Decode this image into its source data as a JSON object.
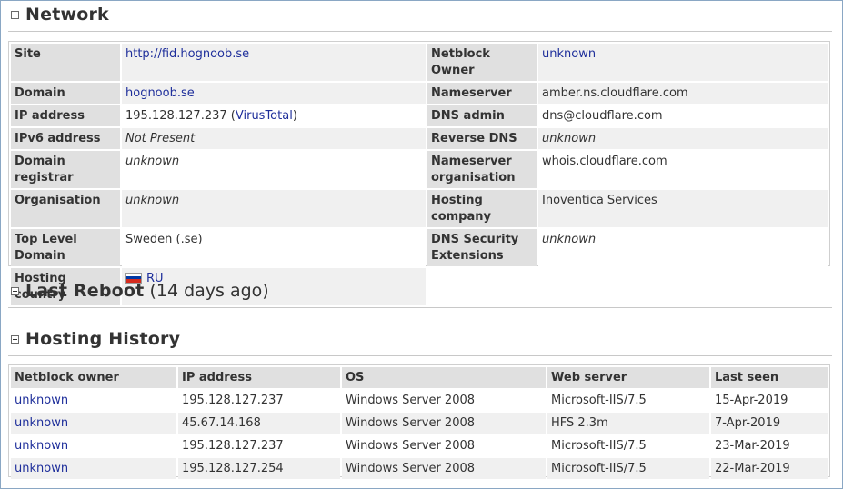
{
  "network": {
    "title": "Network",
    "left_rows": [
      {
        "label": "Site",
        "value": "http://fid.hognoob.se",
        "kind": "link"
      },
      {
        "label": "Domain",
        "value": "hognoob.se",
        "kind": "link"
      },
      {
        "label": "IP address",
        "value": "195.128.127.237",
        "extra_link": "VirusTotal",
        "kind": "ip"
      },
      {
        "label": "IPv6 address",
        "value": "Not Present",
        "kind": "italic"
      },
      {
        "label": "Domain registrar",
        "value": "unknown",
        "kind": "italic"
      },
      {
        "label": "Organisation",
        "value": "unknown",
        "kind": "italic"
      },
      {
        "label": "Top Level Domain",
        "value": "Sweden (.se)",
        "kind": "text"
      },
      {
        "label": "Hosting country",
        "value": "RU",
        "kind": "flag"
      }
    ],
    "right_rows": [
      {
        "label": "Netblock Owner",
        "value": "unknown",
        "kind": "link"
      },
      {
        "label": "Nameserver",
        "value": "amber.ns.cloudflare.com",
        "kind": "text"
      },
      {
        "label": "DNS admin",
        "value": "dns@cloudflare.com",
        "kind": "text"
      },
      {
        "label": "Reverse DNS",
        "value": "unknown",
        "kind": "italic"
      },
      {
        "label": "Nameserver organisation",
        "value": "whois.cloudflare.com",
        "kind": "text"
      },
      {
        "label": "Hosting company",
        "value": "Inoventica Services",
        "kind": "text"
      },
      {
        "label": "DNS Security Extensions",
        "value": "unknown",
        "kind": "italic"
      }
    ]
  },
  "last_reboot": {
    "title": "Last Reboot",
    "subtitle": "(14 days ago)"
  },
  "hosting_history": {
    "title": "Hosting History",
    "columns": [
      "Netblock owner",
      "IP address",
      "OS",
      "Web server",
      "Last seen"
    ],
    "rows": [
      [
        "unknown",
        "195.128.127.237",
        "Windows Server 2008",
        "Microsoft-IIS/7.5",
        "15-Apr-2019"
      ],
      [
        "unknown",
        "45.67.14.168",
        "Windows Server 2008",
        "HFS 2.3m",
        "7-Apr-2019"
      ],
      [
        "unknown",
        "195.128.127.237",
        "Windows Server 2008",
        "Microsoft-IIS/7.5",
        "23-Mar-2019"
      ],
      [
        "unknown",
        "195.128.127.254",
        "Windows Server 2008",
        "Microsoft-IIS/7.5",
        "22-Mar-2019"
      ]
    ]
  },
  "colors": {
    "link": "#1f2f9b",
    "header_cell": "#e0e0e0",
    "row_shade": "#f0f0f0",
    "border": "#8aa7c4"
  }
}
